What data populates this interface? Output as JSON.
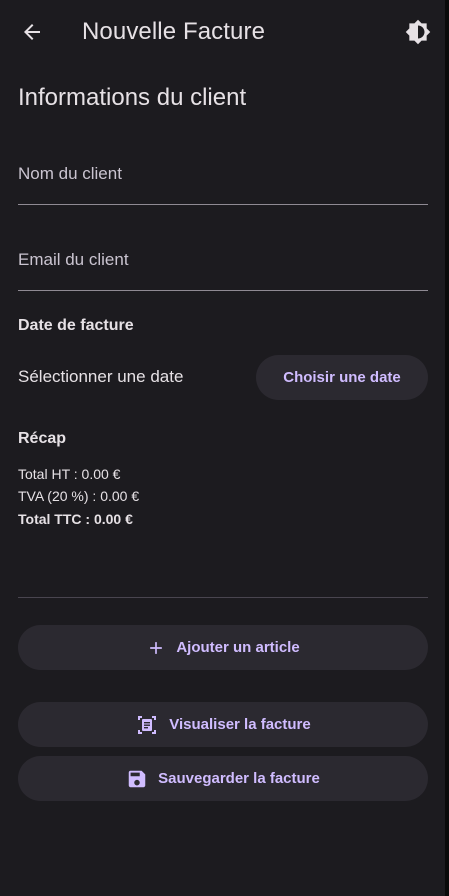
{
  "appbar": {
    "title": "Nouvelle Facture",
    "back_icon": "arrow-left-icon",
    "theme_icon": "brightness-icon"
  },
  "client": {
    "section_title": "Informations du client",
    "name_placeholder": "Nom du client",
    "email_placeholder": "Email du client"
  },
  "date": {
    "heading": "Date de facture",
    "label": "Sélectionner une date",
    "button_label": "Choisir une date"
  },
  "recap": {
    "heading": "Récap",
    "total_ht": "Total HT : 0.00 €",
    "tva": "TVA (20 %) : 0.00 €",
    "total_ttc": "Total TTC : 0.00 €"
  },
  "actions": {
    "add_label": "Ajouter un article",
    "view_label": "Visualiser la facture",
    "save_label": "Sauvegarder la facture"
  },
  "colors": {
    "background": "#1c1b1f",
    "surface_button": "#2b2930",
    "accent": "#d0bcff",
    "text": "#e6e1e5"
  }
}
